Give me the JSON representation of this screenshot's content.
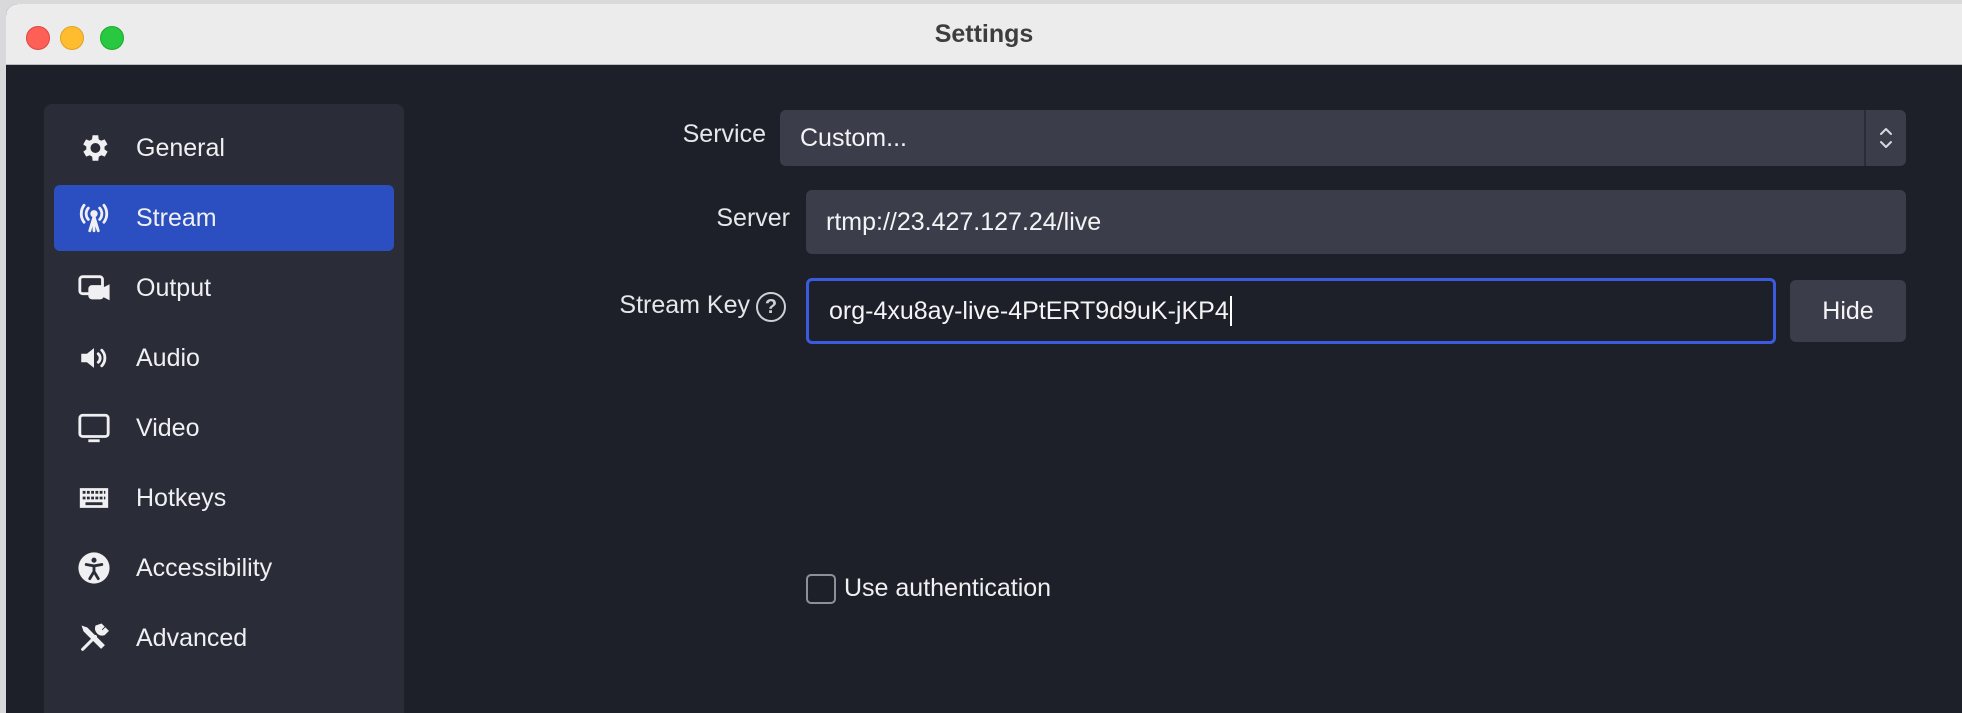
{
  "window": {
    "title": "Settings"
  },
  "sidebar": {
    "items": [
      {
        "label": "General",
        "icon": "gear-icon",
        "active": false
      },
      {
        "label": "Stream",
        "icon": "antenna-icon",
        "active": true
      },
      {
        "label": "Output",
        "icon": "output-icon",
        "active": false
      },
      {
        "label": "Audio",
        "icon": "speaker-icon",
        "active": false
      },
      {
        "label": "Video",
        "icon": "monitor-icon",
        "active": false
      },
      {
        "label": "Hotkeys",
        "icon": "keyboard-icon",
        "active": false
      },
      {
        "label": "Accessibility",
        "icon": "accessibility-icon",
        "active": false
      },
      {
        "label": "Advanced",
        "icon": "tools-icon",
        "active": false
      }
    ]
  },
  "form": {
    "service_label": "Service",
    "service_value": "Custom...",
    "server_label": "Server",
    "server_value": "rtmp://23.427.127.24/live",
    "stream_key_label": "Stream Key",
    "stream_key_value": "org-4xu8ay-live-4PtERT9d9uK-jKP4",
    "help_glyph": "?",
    "hide_label": "Hide",
    "use_auth_label": "Use authentication",
    "use_auth_checked": false
  },
  "colors": {
    "accent": "#2b4fc0",
    "focus_border": "#3a5be0",
    "background": "#1e2029",
    "sidebar": "#2a2c38"
  }
}
